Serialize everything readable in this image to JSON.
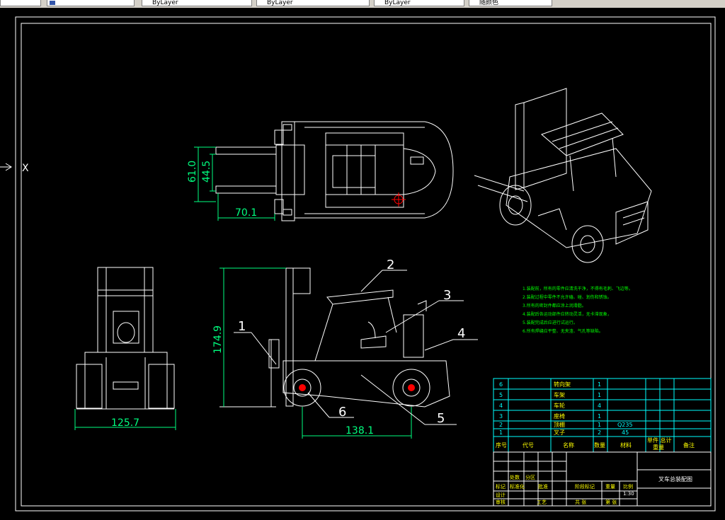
{
  "toolbar": {
    "layer_value": "ByLayer",
    "linetype_value": "ByLayer",
    "lineweight_value": "ByLayer",
    "plot_style_value": "随颜色"
  },
  "colors": {
    "background": "#000000",
    "frame": "#ffffff",
    "dimension": "#00ff7f",
    "leader": "#ffffff",
    "table": "#00ffff",
    "notes": "#00ff00",
    "text_yellow": "#ffff00"
  },
  "ucs_axis_label": "X",
  "dimensions": {
    "top_width_outer": "61.0",
    "top_width_inner": "44.5",
    "top_fork_length": "70.1",
    "side_height": "174.9",
    "side_wheelbase": "138.1",
    "front_track": "125.7"
  },
  "balloons": [
    "1",
    "2",
    "3",
    "4",
    "5",
    "6"
  ],
  "parts_table": {
    "rows": [
      {
        "no": "6",
        "name": "转向架",
        "qty": "1",
        "material": "",
        "mass": ""
      },
      {
        "no": "5",
        "name": "车架",
        "qty": "1",
        "material": "",
        "mass": ""
      },
      {
        "no": "4",
        "name": "车轮",
        "qty": "4",
        "material": "",
        "mass": ""
      },
      {
        "no": "3",
        "name": "座椅",
        "qty": "1",
        "material": "",
        "mass": ""
      },
      {
        "no": "2",
        "name": "顶棚",
        "qty": "1",
        "material": "Q235",
        "mass": ""
      },
      {
        "no": "1",
        "name": "叉子",
        "qty": "2",
        "material": "45",
        "mass": ""
      }
    ],
    "header": {
      "no": "序号",
      "code": "代号",
      "name": "名称",
      "qty": "数量",
      "material": "材料",
      "mass": "单件 总计",
      "weight": "重量",
      "remark": "备注"
    }
  },
  "title_block": {
    "drawing_title": "叉车总装配图",
    "scale": "1:30",
    "labels": [
      "标记",
      "处数",
      "分区",
      "设计",
      "审核",
      "工艺",
      "阶段标记",
      "重量",
      "比例",
      "共 张",
      "第 张",
      "标准化",
      "批准"
    ]
  },
  "notes": [
    "1.装配前，所有的零件应清洗干净，不得有毛刺、飞边等。",
    "2.装配过程中零件不允许磕、碰、划伤和锈蚀。",
    "3.所有的密封件都应涂上润滑脂。",
    "4.装配后各运动部件应转动灵活，无卡滞现象，",
    "5.装配完成后应进行试运行。",
    "6.所有焊缝应平整、无夹渣、气孔等缺陷。"
  ]
}
